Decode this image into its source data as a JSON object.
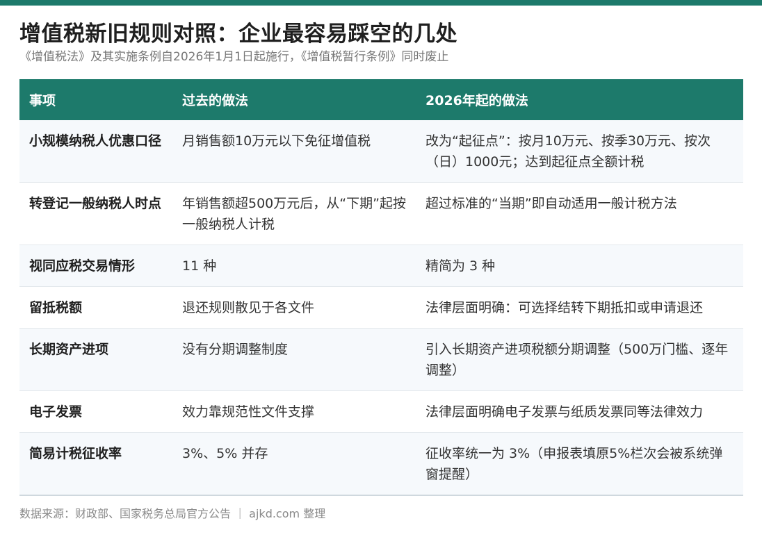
{
  "header": {
    "title": "增值税新旧规则对照：企业最容易踩空的几处",
    "subtitle": "《增值税法》及其实施条例自2026年1月1日起施行，《增值税暂行条例》同时废止"
  },
  "table": {
    "columns": [
      "事项",
      "过去的做法",
      "2026年起的做法"
    ],
    "rows": [
      [
        "小规模纳税人优惠口径",
        "月销售额10万元以下免征增值税",
        "改为“起征点”：按月10万元、按季30万元、按次（日）1000元；达到起征点全额计税"
      ],
      [
        "转登记一般纳税人时点",
        "年销售额超500万元后，从“下期”起按一般纳税人计税",
        "超过标准的“当期”即自动适用一般计税方法"
      ],
      [
        "视同应税交易情形",
        "11 种",
        "精简为 3 种"
      ],
      [
        "留抵税额",
        "退还规则散见于各文件",
        "法律层面明确：可选择结转下期抵扣或申请退还"
      ],
      [
        "长期资产进项",
        "没有分期调整制度",
        "引入长期资产进项税额分期调整（500万门槛、逐年调整）"
      ],
      [
        "电子发票",
        "效力靠规范性文件支撑",
        "法律层面明确电子发票与纸质发票同等法律效力"
      ],
      [
        "简易计税征收率",
        "3%、5% 并存",
        "征收率统一为 3%（申报表填原5%栏次会被系统弹窗提醒）"
      ]
    ]
  },
  "footer": {
    "source": "数据来源：财政部、国家税务总局官方公告 ｜ ajkd.com 整理"
  },
  "colors": {
    "accent": "#1d7a6b",
    "row_alt": "#f6f9fc"
  }
}
